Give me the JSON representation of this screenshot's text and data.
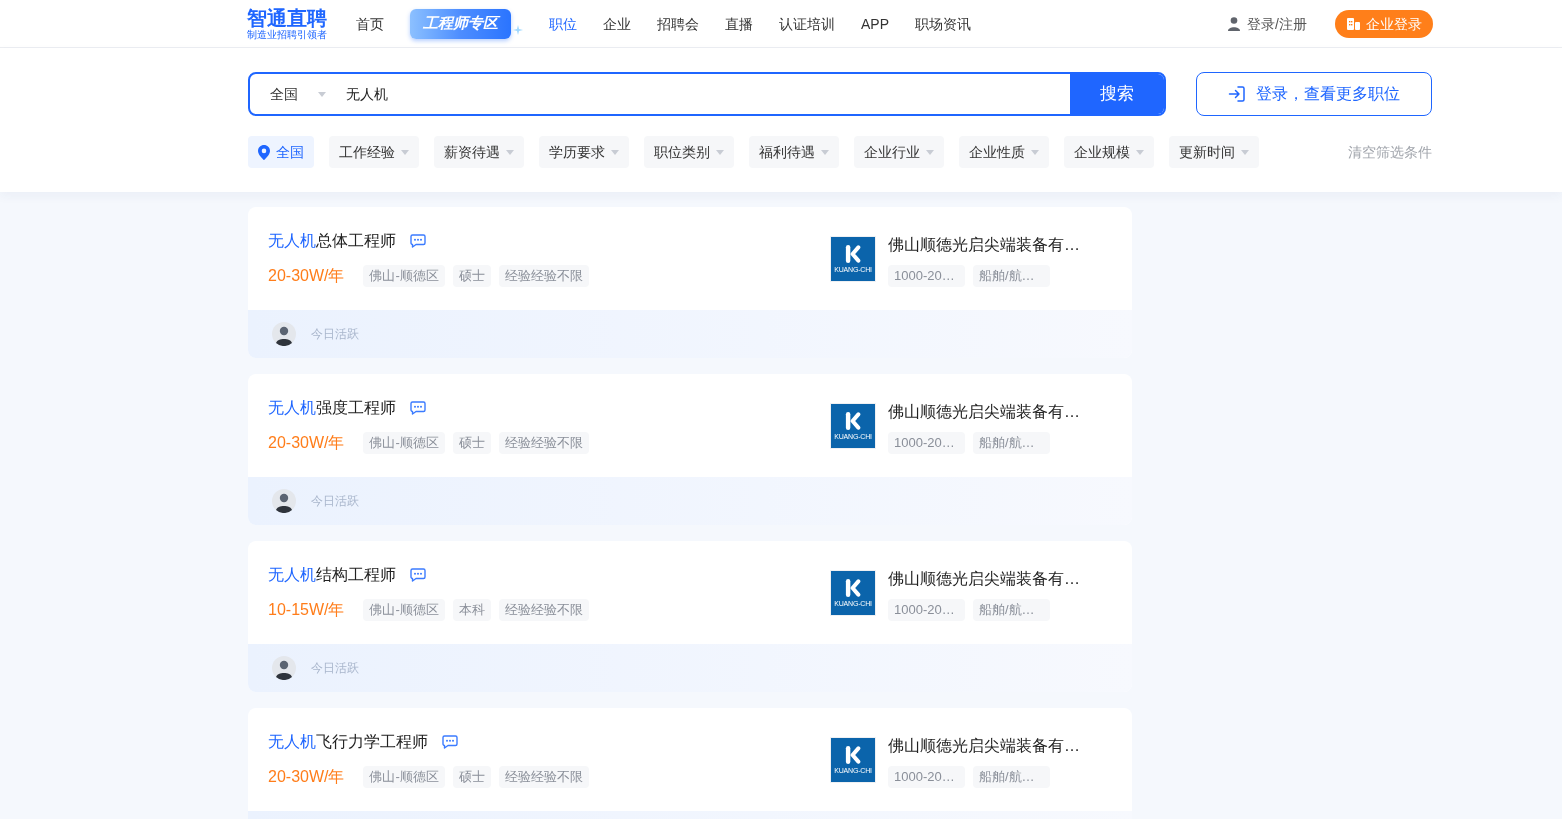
{
  "header": {
    "logo": {
      "name": "智通直聘",
      "tagline": "制造业招聘引领者"
    },
    "nav": [
      {
        "label": "首页",
        "kind": "link",
        "selected": false
      },
      {
        "label": "工程师专区",
        "kind": "badge",
        "selected": false
      },
      {
        "label": "职位",
        "kind": "link",
        "selected": true
      },
      {
        "label": "企业",
        "kind": "link",
        "selected": false
      },
      {
        "label": "招聘会",
        "kind": "link",
        "selected": false
      },
      {
        "label": "直播",
        "kind": "link",
        "selected": false
      },
      {
        "label": "认证培训",
        "kind": "link",
        "selected": false
      },
      {
        "label": "APP",
        "kind": "link",
        "selected": false
      },
      {
        "label": "职场资讯",
        "kind": "link",
        "selected": false
      }
    ],
    "user_link": "登录/注册",
    "company_login": "企业登录"
  },
  "search": {
    "region": "全国",
    "value": "无人机",
    "button": "搜索",
    "login_prompt": "登录，查看更多职位"
  },
  "filters": [
    {
      "label": "全国",
      "kind": "location",
      "selected": true
    },
    {
      "label": "工作经验",
      "kind": "dropdown",
      "selected": false
    },
    {
      "label": "薪资待遇",
      "kind": "dropdown",
      "selected": false
    },
    {
      "label": "学历要求",
      "kind": "dropdown",
      "selected": false
    },
    {
      "label": "职位类别",
      "kind": "dropdown",
      "selected": false
    },
    {
      "label": "福利待遇",
      "kind": "dropdown",
      "selected": false
    },
    {
      "label": "企业行业",
      "kind": "dropdown",
      "selected": false
    },
    {
      "label": "企业性质",
      "kind": "dropdown",
      "selected": false
    },
    {
      "label": "企业规模",
      "kind": "dropdown",
      "selected": false
    },
    {
      "label": "更新时间",
      "kind": "dropdown",
      "selected": false
    }
  ],
  "clear_filters": "清空筛选条件",
  "jobs": [
    {
      "title_keyword": "无人机",
      "title_rest": "总体工程师",
      "salary": "20-30W/年",
      "tags": [
        "佛山-顺德区",
        "硕士",
        "经验经验不限"
      ],
      "activity": "今日活跃",
      "company": {
        "logo_text": "KUANG-CHI",
        "name": "佛山顺德光启尖端装备有…",
        "tags": [
          "1000-20…",
          "船舶/航…"
        ]
      }
    },
    {
      "title_keyword": "无人机",
      "title_rest": "强度工程师",
      "salary": "20-30W/年",
      "tags": [
        "佛山-顺德区",
        "硕士",
        "经验经验不限"
      ],
      "activity": "今日活跃",
      "company": {
        "logo_text": "KUANG-CHI",
        "name": "佛山顺德光启尖端装备有…",
        "tags": [
          "1000-20…",
          "船舶/航…"
        ]
      }
    },
    {
      "title_keyword": "无人机",
      "title_rest": "结构工程师",
      "salary": "10-15W/年",
      "tags": [
        "佛山-顺德区",
        "本科",
        "经验经验不限"
      ],
      "activity": "今日活跃",
      "company": {
        "logo_text": "KUANG-CHI",
        "name": "佛山顺德光启尖端装备有…",
        "tags": [
          "1000-20…",
          "船舶/航…"
        ]
      }
    },
    {
      "title_keyword": "无人机",
      "title_rest": "飞行力学工程师",
      "salary": "20-30W/年",
      "tags": [
        "佛山-顺德区",
        "硕士",
        "经验经验不限"
      ],
      "company": {
        "logo_text": "KUANG-CHI",
        "name": "佛山顺德光启尖端装备有…",
        "tags": [
          "1000-20…",
          "船舶/航…"
        ]
      }
    }
  ]
}
